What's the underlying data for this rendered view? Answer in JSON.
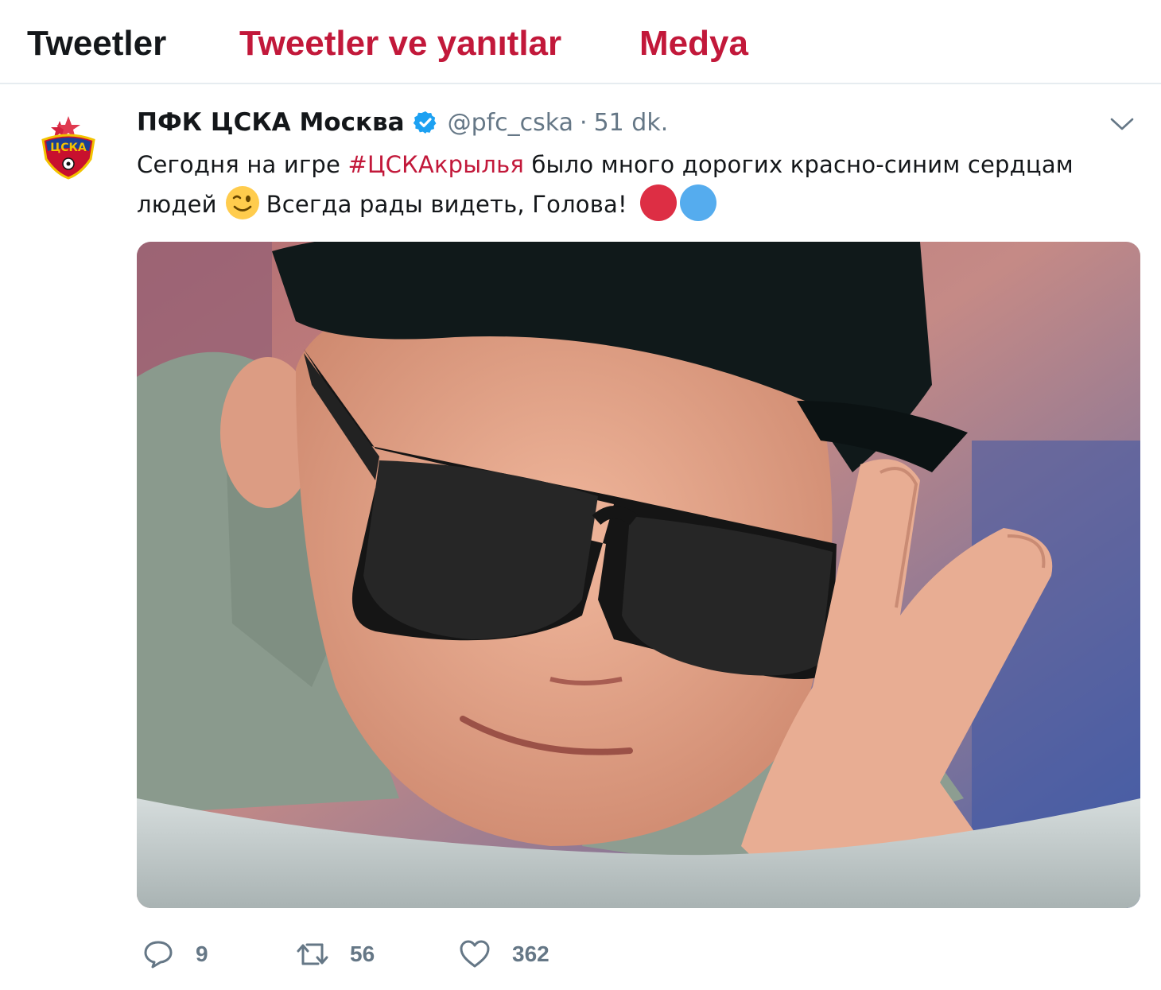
{
  "tabs": [
    {
      "label": "Tweetler",
      "active": true
    },
    {
      "label": "Tweetler ve yanıtlar",
      "active": false
    },
    {
      "label": "Medya",
      "active": false
    }
  ],
  "tweet": {
    "display_name": "ПФК ЦСКА Москва",
    "verified": true,
    "handle": "@pfc_cska",
    "separator": "·",
    "time": "51 dk.",
    "text_before": "Сегодня на игре ",
    "hashtag": "#ЦСКАкрылья",
    "text_middle": " было много дорогих красно-синим сердцам людей",
    "text_after": "Всегда рады видеть, Голова!",
    "emojis": [
      "winking-face",
      "red-circle",
      "blue-circle"
    ],
    "avatar_text": "ЦСКА",
    "stats": {
      "replies": "9",
      "retweets": "56",
      "likes": "362"
    }
  },
  "colors": {
    "accent": "#c2183a",
    "muted": "#657786",
    "verified": "#1da1f2",
    "red_circle": "#dd2e44",
    "blue_circle": "#55acee"
  }
}
